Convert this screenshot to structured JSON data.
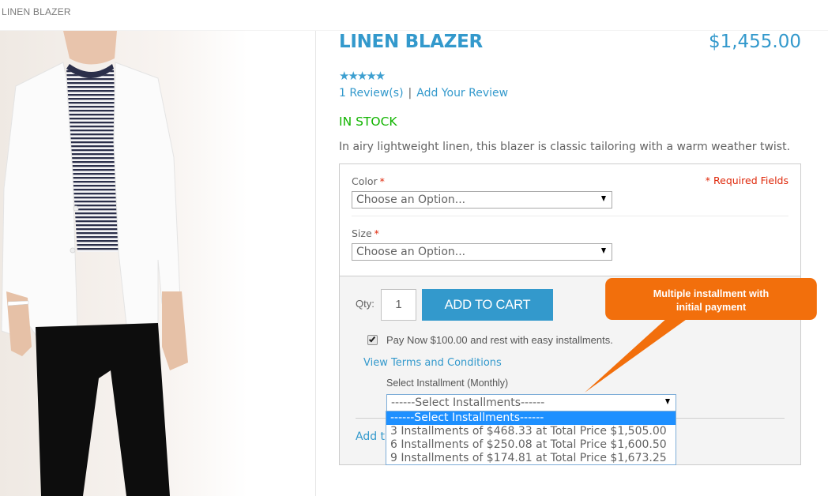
{
  "breadcrumb": "LINEN BLAZER",
  "product": {
    "title": "LINEN BLAZER",
    "price": "$1,455.00",
    "rating": {
      "stars": 5,
      "max": 5,
      "glyph": "★★★★★"
    },
    "reviews_link": "1 Review(s)",
    "separator": "|",
    "add_review_link": "Add Your Review",
    "stock_status": "IN STOCK",
    "description": "In airy lightweight linen, this blazer is classic tailoring with a warm weather twist.",
    "image_alt": "Man wearing white linen blazer, striped t-shirt and black jeans"
  },
  "options": {
    "required_note": "* Required Fields",
    "required_marker": "*",
    "color": {
      "label": "Color",
      "value": "Choose an Option..."
    },
    "size": {
      "label": "Size",
      "value": "Choose an Option..."
    }
  },
  "cart": {
    "qty_label": "Qty:",
    "qty_value": "1",
    "add_to_cart_label": "ADD TO CART",
    "pay_now_checked": true,
    "pay_now_text": "Pay Now $100.00 and rest with easy installments.",
    "terms_link": "View Terms and Conditions",
    "installment_label": "Select Installment (Monthly)",
    "installment_value": "------Select Installments------",
    "installment_options": [
      "------Select Installments------",
      "3 Installments of $468.33 at Total Price $1,505.00",
      "6 Installments of $250.08 at Total Price $1,600.50",
      "9 Installments of $174.81 at Total Price $1,673.25"
    ],
    "wishlist_link_partial": "Add t"
  },
  "callout": {
    "line1": "Multiple installment with",
    "line2": "initial payment",
    "color": "#f26f0c"
  },
  "colors": {
    "accent": "#3399cc",
    "in_stock": "#11b400",
    "required": "#df280a",
    "dropdown_highlight": "#1e90ff"
  }
}
